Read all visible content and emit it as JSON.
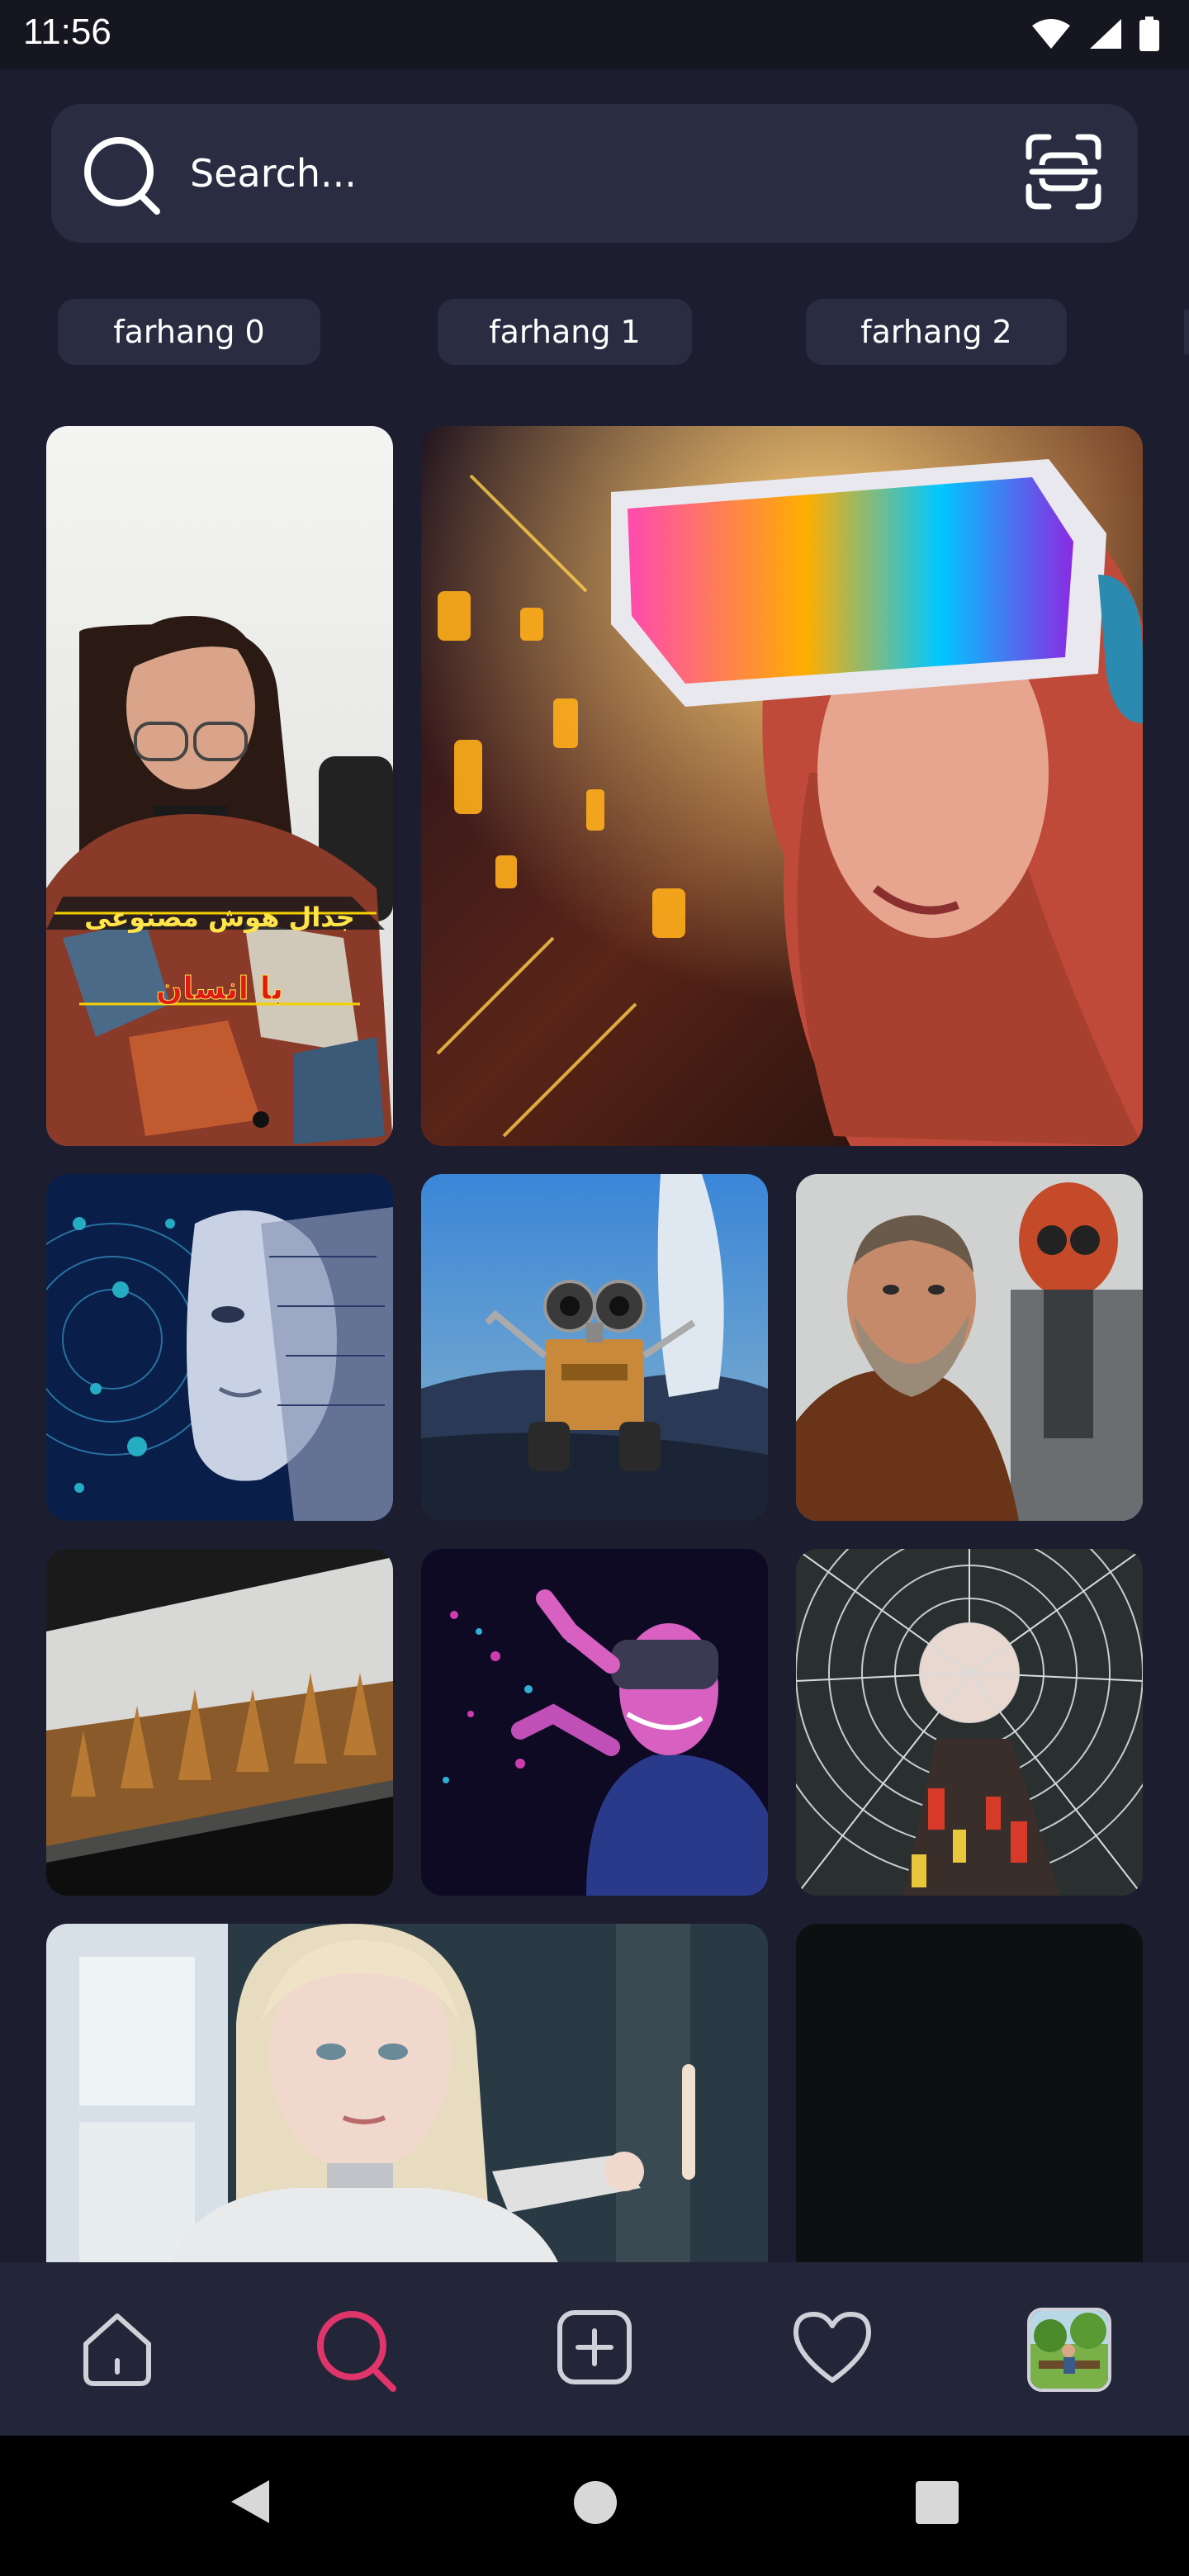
{
  "status_bar": {
    "time": "11:56",
    "icons": [
      "wifi-icon",
      "signal-icon",
      "battery-icon"
    ]
  },
  "search": {
    "placeholder": "Search...",
    "icon": "search-icon",
    "scan_icon": "scan-icon"
  },
  "chips": [
    {
      "label": "farhang 0"
    },
    {
      "label": "farhang 1"
    },
    {
      "label": "farhang 2"
    }
  ],
  "grid": {
    "items": [
      {
        "kind": "video-thumbnail",
        "overlay_line1": "جدال هوش مصنوعی",
        "overlay_line2": "با انسان"
      },
      {
        "kind": "image",
        "subject": "vr-woman"
      },
      {
        "kind": "image",
        "subject": "circuit-face"
      },
      {
        "kind": "image",
        "subject": "robot-walle"
      },
      {
        "kind": "image",
        "subject": "man-with-robot"
      },
      {
        "kind": "image",
        "subject": "autumn-forest-window"
      },
      {
        "kind": "image",
        "subject": "vr-neon-person"
      },
      {
        "kind": "image",
        "subject": "building-atrium"
      },
      {
        "kind": "image",
        "subject": "android-girl"
      },
      {
        "kind": "image",
        "subject": "dark-placeholder"
      }
    ]
  },
  "bottom_nav": {
    "items": [
      {
        "icon": "home-icon",
        "active": false
      },
      {
        "icon": "search-icon",
        "active": true
      },
      {
        "icon": "add-post-icon",
        "active": false
      },
      {
        "icon": "heart-icon",
        "active": false
      },
      {
        "icon": "profile-avatar",
        "active": false
      }
    ],
    "active_color": "#e0356a"
  },
  "system_nav": [
    "back-icon",
    "home-circle-icon",
    "recents-icon"
  ]
}
